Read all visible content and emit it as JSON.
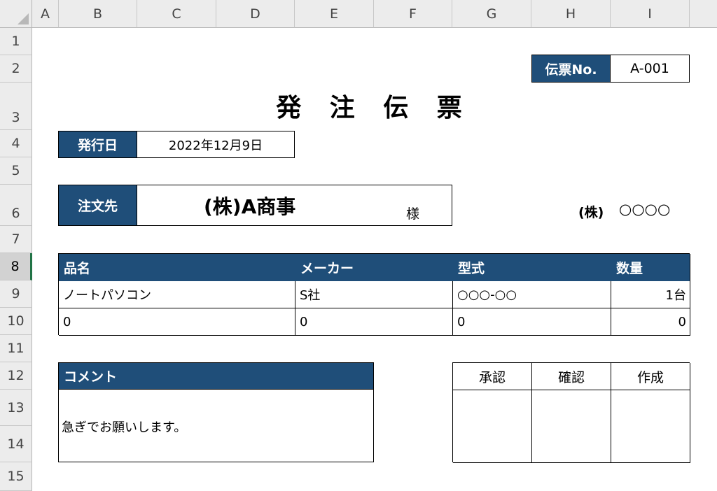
{
  "sheet": {
    "columns": [
      "A",
      "B",
      "C",
      "D",
      "E",
      "F",
      "G",
      "H",
      "I"
    ],
    "rows": [
      "1",
      "2",
      "3",
      "4",
      "5",
      "6",
      "7",
      "8",
      "9",
      "10",
      "11",
      "12",
      "13",
      "14",
      "15"
    ]
  },
  "slip": {
    "number_label": "伝票No.",
    "number_value": "A-001",
    "title": "発 注 伝 票",
    "issue_label": "発行日",
    "issue_value": "2022年12月9日",
    "to_label": "注文先",
    "to_value": "(株)A商事",
    "honorific": "様",
    "issuer_prefix": "(株)",
    "issuer_name": "○○○○"
  },
  "items": {
    "headers": [
      "品名",
      "メーカー",
      "型式",
      "数量"
    ],
    "rows": [
      [
        "ノートパソコン",
        "S社",
        "○○○-○○",
        "1台"
      ],
      [
        "0",
        "0",
        "0",
        "0"
      ]
    ]
  },
  "comment": {
    "label": "コメント",
    "text": "急ぎでお願いします。"
  },
  "approval": {
    "headers": [
      "承認",
      "確認",
      "作成"
    ]
  },
  "colors": {
    "header_bg": "#1f4e79",
    "selection": "#217346"
  }
}
